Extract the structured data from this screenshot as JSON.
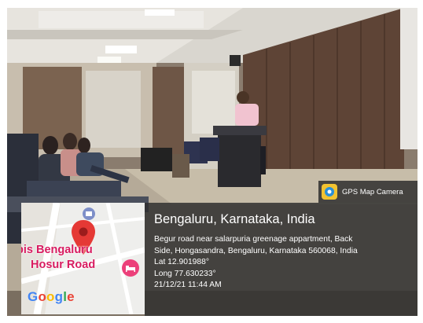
{
  "badge": {
    "label": "GPS Map Camera",
    "icon": "gps-map-camera-app-icon"
  },
  "location": {
    "title": "Bengaluru, Karnataka, India",
    "address_line_1": "Begur road near salarpuria greenage appartment, Back",
    "address_line_2": "Side, Hongasandra, Bengaluru, Karnataka 560068, India",
    "latitude": "Lat 12.901988°",
    "longitude": "Long 77.630233°",
    "timestamp": "21/12/21 11:44 AM"
  },
  "map": {
    "label_line_1": "bis Bengaluru",
    "label_line_2": "Hosur Road",
    "provider": "Google",
    "pin_icon": "location-pin-icon",
    "hotel_icon": "hotel-bed-icon",
    "colors": {
      "pin": "#e53935",
      "poi": "#d81b60",
      "google_blue": "#4285f4",
      "google_red": "#ea4335",
      "google_yellow": "#fbbc05",
      "google_green": "#34a853"
    }
  },
  "photo": {
    "description_icon": "lecture-hall-photo"
  }
}
